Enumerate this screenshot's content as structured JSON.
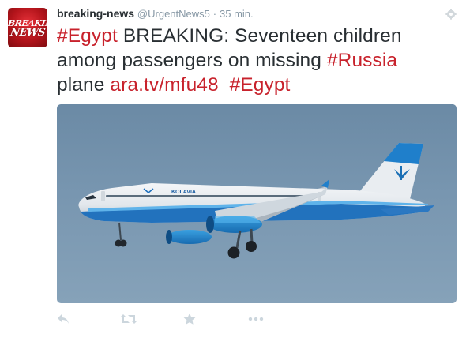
{
  "author": {
    "avatar_line1": "BREAKING",
    "avatar_line2": "NEWS",
    "name": "breaking-news",
    "handle": "@UrgentNews5",
    "separator": "·",
    "time": "35 min."
  },
  "tweet": {
    "tag1": "#Egypt",
    "text1": "BREAKING: Seventeen children among passengers on missing",
    "tag2": "#Russia",
    "text2": "plane",
    "link": "ara.tv/mfu48",
    "tag3": "#Egypt"
  },
  "media": {
    "livery_text": "KOLAVIA"
  },
  "actions": [
    {
      "name": "reply",
      "icon": "reply-icon"
    },
    {
      "name": "retweet",
      "icon": "retweet-icon"
    },
    {
      "name": "favorite",
      "icon": "star-icon"
    },
    {
      "name": "more",
      "icon": "more-icon"
    }
  ],
  "colors": {
    "hashtag": "#c8222c",
    "muted": "#8899a6",
    "text": "#292f33",
    "icon": "#ccd6dd"
  }
}
